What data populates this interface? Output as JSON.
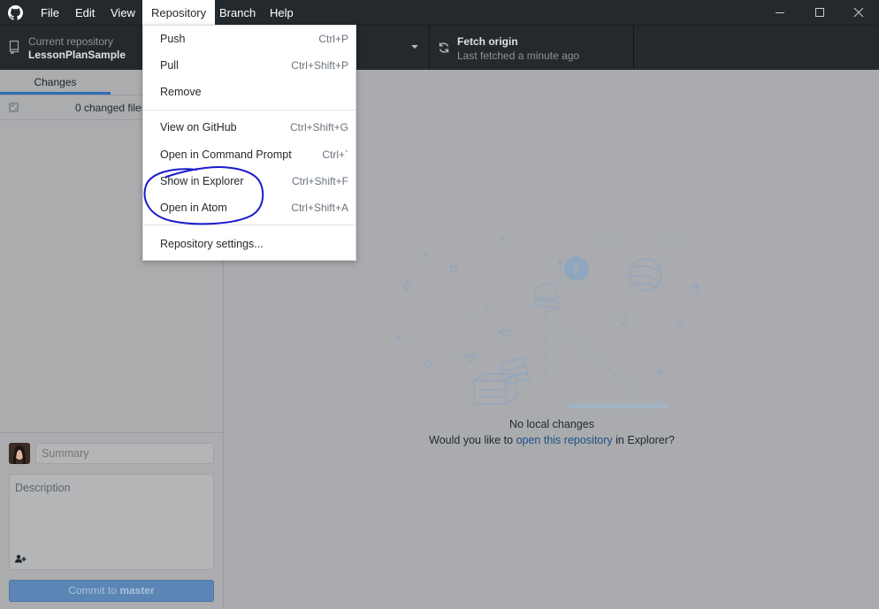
{
  "menubar": {
    "items": [
      "File",
      "Edit",
      "View",
      "Repository",
      "Branch",
      "Help"
    ],
    "active": "Repository"
  },
  "toolbar": {
    "repository_label": "Current repository",
    "repository_value": "LessonPlanSample",
    "fetch_label": "Fetch origin",
    "fetch_sub": "Last fetched a minute ago"
  },
  "left_panel": {
    "tab_changes": "Changes",
    "changed_files": "0 changed files",
    "summary_placeholder": "Summary",
    "description_placeholder": "Description",
    "commit_prefix": "Commit to ",
    "commit_branch": "master"
  },
  "repository_menu": {
    "items": [
      {
        "label": "Push",
        "accelerator": "Ctrl+P"
      },
      {
        "label": "Pull",
        "accelerator": "Ctrl+Shift+P"
      },
      {
        "label": "Remove",
        "accelerator": ""
      },
      {
        "label": "View on GitHub",
        "accelerator": "Ctrl+Shift+G"
      },
      {
        "label": "Open in Command Prompt",
        "accelerator": "Ctrl+`"
      },
      {
        "label": "Show in Explorer",
        "accelerator": "Ctrl+Shift+F"
      },
      {
        "label": "Open in Atom",
        "accelerator": "Ctrl+Shift+A"
      },
      {
        "label": "Repository settings...",
        "accelerator": ""
      }
    ]
  },
  "blank_slate": {
    "title": "No local changes",
    "prefix": "Would you like to ",
    "link": "open this repository",
    "suffix": " in Explorer?"
  },
  "colors": {
    "titlebar": "#24292e",
    "accent": "#2c6db5",
    "annotation": "#1a1acc",
    "commit_button": "#5b85b4"
  }
}
